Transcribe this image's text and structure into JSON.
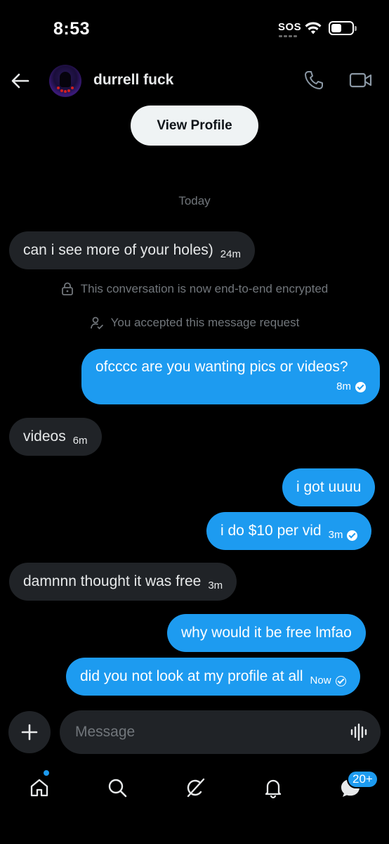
{
  "status_bar": {
    "time": "8:53",
    "sos": "SOS"
  },
  "header": {
    "contact_name": "durrell fuck",
    "view_profile_label": "View Profile"
  },
  "conversation": {
    "day_label": "Today",
    "encrypted_note": "This conversation is now end-to-end encrypted",
    "accepted_note": "You accepted this message request",
    "messages": [
      {
        "direction": "in",
        "text": "can i see more of your holes)",
        "time": "24m"
      },
      {
        "direction": "out",
        "text": "ofcccc are you wanting pics or videos?",
        "time": "8m",
        "status": "seen"
      },
      {
        "direction": "in",
        "text": "videos",
        "time": "6m"
      },
      {
        "direction": "out",
        "text": "i got uuuu",
        "time": ""
      },
      {
        "direction": "out",
        "text": "i do $10 per vid",
        "time": "3m",
        "status": "seen"
      },
      {
        "direction": "in",
        "text": "damnnn thought it was free",
        "time": "3m"
      },
      {
        "direction": "out",
        "text": "why would it be free lmfao",
        "time": ""
      },
      {
        "direction": "out",
        "text": "did you not look at my profile at all",
        "time": "Now",
        "status": "sent"
      }
    ]
  },
  "composer": {
    "placeholder": "Message"
  },
  "bottom_nav": {
    "items": [
      "home-icon",
      "search-icon",
      "grok-icon",
      "notifications-icon",
      "messages-icon"
    ],
    "messages_badge": "20+"
  },
  "colors": {
    "accent": "#1d9bf0",
    "incoming_bubble": "#202327",
    "background": "#000000"
  }
}
